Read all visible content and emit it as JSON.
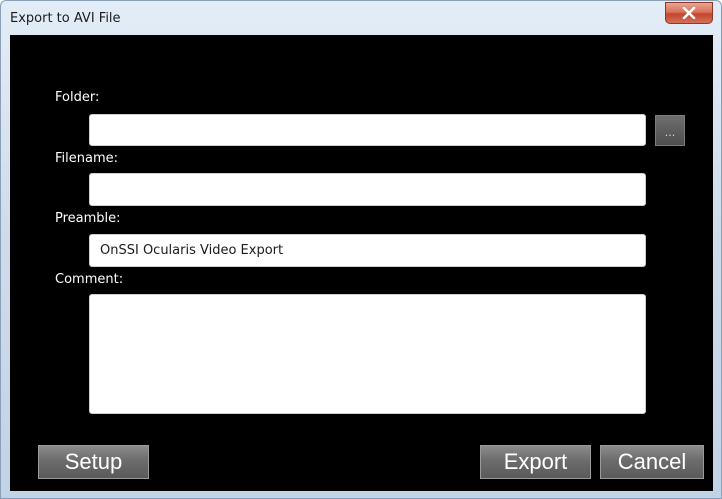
{
  "window": {
    "title": "Export to AVI File"
  },
  "form": {
    "folder_label": "Folder:",
    "folder_value": "",
    "browse_label": "...",
    "filename_label": "Filename:",
    "filename_value": "",
    "preamble_label": "Preamble:",
    "preamble_value": "OnSSI Ocularis Video Export",
    "comment_label": "Comment:",
    "comment_value": ""
  },
  "buttons": {
    "setup": "Setup",
    "export": "Export",
    "cancel": "Cancel"
  },
  "icons": {
    "close": "close-icon"
  },
  "colors": {
    "content_bg": "#000000",
    "close_button": "#c9523a",
    "button_gray": "#6c6c6c"
  }
}
